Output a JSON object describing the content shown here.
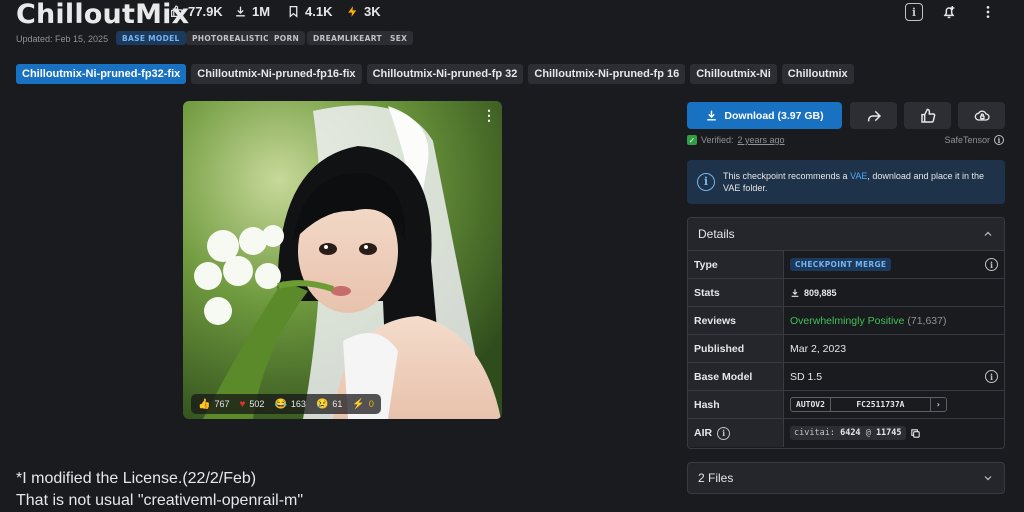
{
  "model": {
    "title": "ChilloutMix",
    "stats": {
      "likes": "77.9K",
      "downloads": "1M",
      "bookmarks": "4.1K",
      "buzz": "3K"
    },
    "updated": "Updated: Feb 15, 2025",
    "badges": [
      "BASE MODEL",
      "PHOTOREALISTIC",
      "PORN",
      "DREAMLIKEART",
      "SEX"
    ]
  },
  "versions": [
    "Chilloutmix-Ni-pruned-fp32-fix",
    "Chilloutmix-Ni-pruned-fp16-fix",
    "Chilloutmix-Ni-pruned-fp 32",
    "Chilloutmix-Ni-pruned-fp 16",
    "Chilloutmix-Ni",
    "Chilloutmix"
  ],
  "image": {
    "reactions": {
      "like": "767",
      "heart": "502",
      "laugh": "163",
      "cry": "61",
      "buzz": "0"
    }
  },
  "download": {
    "label": "Download (3.97 GB)",
    "verified_label": "Verified:",
    "verified_time": "2 years ago",
    "safetensor": "SafeTensor"
  },
  "alert": {
    "pre": "This checkpoint recommends a ",
    "link": "VAE",
    "post": ", download and place it in the VAE folder."
  },
  "details": {
    "header": "Details",
    "type_label": "Type",
    "type_value": "CHECKPOINT MERGE",
    "stats_label": "Stats",
    "stats_value": "809,885",
    "reviews_label": "Reviews",
    "reviews_value": "Overwhelmingly Positive",
    "reviews_count": "(71,637)",
    "published_label": "Published",
    "published_value": "Mar 2, 2023",
    "base_label": "Base Model",
    "base_value": "SD 1.5",
    "hash_label": "Hash",
    "hash_type": "AUTOV2",
    "hash_value": "FC2511737A",
    "air_label": "AIR",
    "air_prefix": "civitai:",
    "air_id": "6424",
    "air_at": "@",
    "air_ver": "11745"
  },
  "files": {
    "label": "2 Files"
  },
  "description": {
    "line1": "*I modified the License.(22/2/Feb)",
    "line2": "That is not usual \"creativeml-openrail-m\""
  },
  "colors": {
    "accent": "#1971c2",
    "bg": "#1a1b1e",
    "positive": "#40c057"
  }
}
